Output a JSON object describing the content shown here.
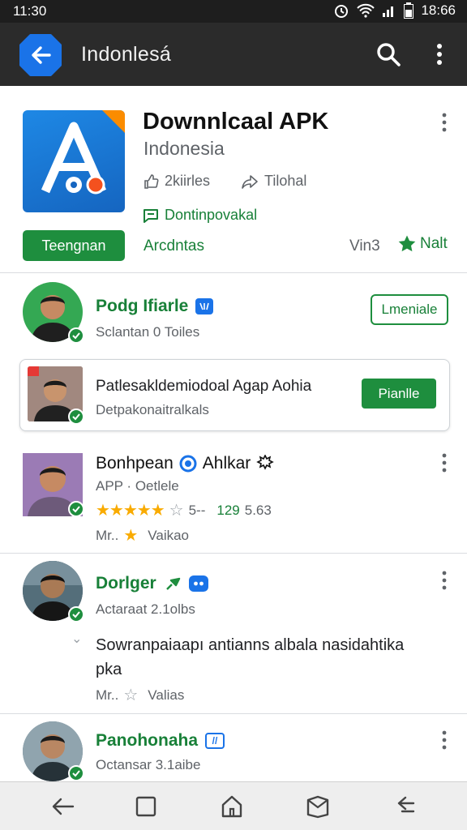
{
  "status_bar": {
    "time_left": "11:30",
    "time_right": "18:66"
  },
  "app_bar": {
    "title": "Indonlesá"
  },
  "header": {
    "title": "Downnlcaal APK",
    "subtitle": "Indonesia",
    "meta_left": "2kiirles",
    "meta_right": "Tilohal",
    "green_meta": "Dontinpovakal",
    "primary_button": "Teengnan",
    "link": "Arcdntas",
    "version": "Vin3",
    "rating_label": "Nalt"
  },
  "items": [
    {
      "title": "Podg Ifiarle",
      "subtitle": "Sclantan 0 Toiles",
      "button": "Lmeniale"
    },
    {
      "title": "Patlesakldemiodoal Agap Aohia",
      "subtitle": "Detpakonaitralkals",
      "button": "Pianlle"
    },
    {
      "title": "Bonhpean",
      "title_extra": "Ahlkar",
      "subtitle": "APP · Oetlele",
      "rating_count": "5--",
      "rating_green": "129",
      "rating_value": "5.63",
      "footer_left": "Mr..",
      "footer_right": "Vaikao"
    },
    {
      "title": "Dorlger",
      "subtitle": "Actaraat 2.1olbs",
      "body": "Sowranpaiaapı antianns albala nasidahtika pka",
      "footer_left": "Mr..",
      "footer_right": "Valias"
    },
    {
      "title": "Panohonaha",
      "subtitle": "Octansar 3.1aibe"
    }
  ],
  "colors": {
    "accent_green": "#1e8e3e",
    "accent_blue": "#1a73e8",
    "app_bar": "#2b2b2b",
    "star": "#f9ab00"
  },
  "icons": [
    "back-arrow-icon",
    "search-icon",
    "more-vert-icon",
    "thumbs-up-icon",
    "share-icon",
    "chat-icon",
    "star-icon",
    "verified-icon",
    "nav-back-icon",
    "nav-square-icon",
    "nav-home-icon",
    "nav-inbox-icon",
    "nav-return-icon"
  ]
}
